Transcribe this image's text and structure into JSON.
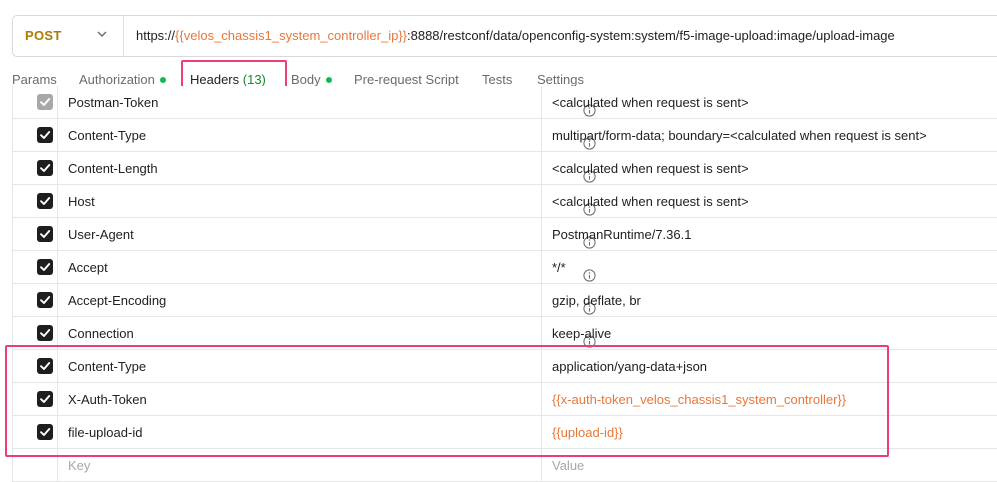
{
  "request": {
    "method": "POST",
    "url_prefix": "https://",
    "url_var": "{{velos_chassis1_system_controller_ip}}",
    "url_suffix": ":8888/restconf/data/openconfig-system:system/f5-image-upload:image/upload-image"
  },
  "tabs": {
    "params": "Params",
    "authorization": "Authorization",
    "headers": "Headers",
    "headers_count": "(13)",
    "body": "Body",
    "prerequest": "Pre-request Script",
    "tests": "Tests",
    "settings": "Settings"
  },
  "headers": [
    {
      "key": "Postman-Token",
      "value": "<calculated when request is sent>",
      "checked": true,
      "disabled": true
    },
    {
      "key": "Content-Type",
      "value": "multipart/form-data; boundary=<calculated when request is sent>",
      "checked": true
    },
    {
      "key": "Content-Length",
      "value": "<calculated when request is sent>",
      "checked": true
    },
    {
      "key": "Host",
      "value": "<calculated when request is sent>",
      "checked": true
    },
    {
      "key": "User-Agent",
      "value": "PostmanRuntime/7.36.1",
      "checked": true
    },
    {
      "key": "Accept",
      "value": "*/*",
      "checked": true
    },
    {
      "key": "Accept-Encoding",
      "value": "gzip, deflate, br",
      "checked": true
    },
    {
      "key": "Connection",
      "value": "keep-alive",
      "checked": true
    },
    {
      "key": "Content-Type",
      "value": "application/yang-data+json",
      "checked": true
    },
    {
      "key": "X-Auth-Token",
      "value": "{{x-auth-token_velos_chassis1_system_controller}}",
      "checked": true
    },
    {
      "key": "file-upload-id",
      "value": "{{upload-id}}",
      "checked": true
    }
  ],
  "new_row": {
    "key_placeholder": "Key",
    "value_placeholder": "Value"
  },
  "colors": {
    "accent": "#e8773a",
    "highlight": "#ec3d78",
    "method": "#ad7a03",
    "dot": "#0cbb52"
  },
  "icons": {
    "method_dropdown": "chevron-down-icon",
    "info": "info-icon",
    "check": "checkmark-icon"
  }
}
